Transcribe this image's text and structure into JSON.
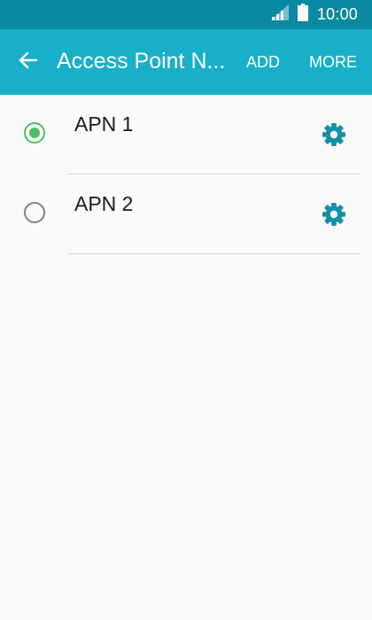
{
  "status_bar": {
    "time": "10:00",
    "signal_icon": "signal-icon",
    "battery_icon": "battery-icon"
  },
  "app_bar": {
    "title": "Access Point N...",
    "back_icon": "back-arrow-icon",
    "actions": {
      "add_label": "ADD",
      "more_label": "MORE"
    }
  },
  "apns": [
    {
      "name": "APN 1",
      "selected": true
    },
    {
      "name": "APN 2",
      "selected": false
    }
  ],
  "colors": {
    "status_bar": "#0a8aa0",
    "app_bar": "#18b0c8",
    "accent_icon": "#1390a8",
    "radio_selected": "#4cc060"
  }
}
